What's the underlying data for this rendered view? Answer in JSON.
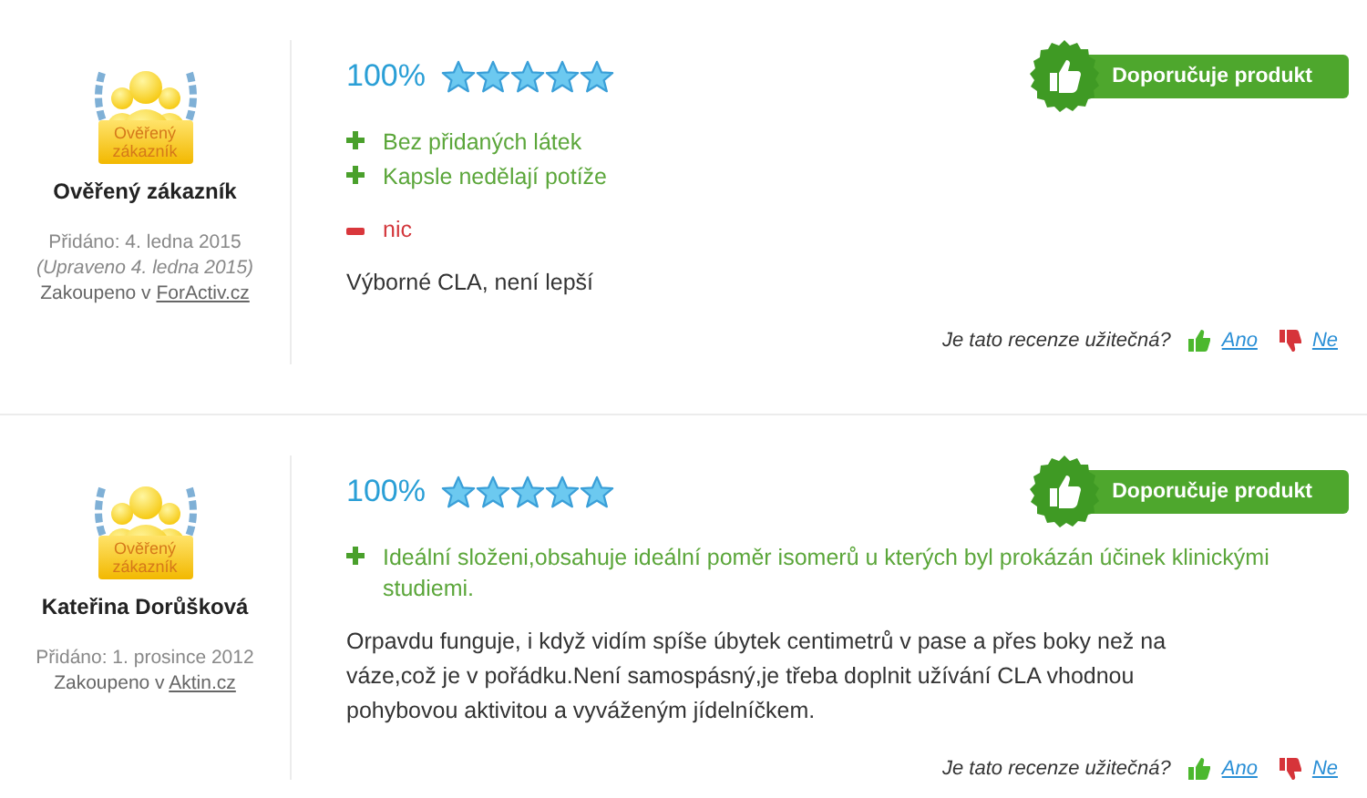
{
  "reviews": [
    {
      "author": {
        "badge_label": "Ověřený zákazník",
        "name": "Ověřený zákazník"
      },
      "added": "Přidáno: 4. ledna 2015",
      "edited": "(Upraveno 4. ledna 2015)",
      "purchased": "Zakoupeno v",
      "shop": "ForActiv.cz",
      "rating": "100%",
      "stars": 5,
      "recommend": "Doporučuje produkt",
      "pros": [
        "Bez přidaných látek",
        "Kapsle nedělají potíže"
      ],
      "cons": [
        "nic"
      ],
      "text": "Výborné CLA, není lepší",
      "helpful": {
        "question": "Je tato recenze užitečná?",
        "yes": "Ano",
        "no": "Ne"
      }
    },
    {
      "author": {
        "badge_label": "Ověřený zákazník",
        "name": "Kateřina Dorůšková"
      },
      "added": "Přidáno: 1. prosince 2012",
      "purchased": "Zakoupeno v",
      "shop": "Aktin.cz",
      "rating": "100%",
      "stars": 5,
      "recommend": "Doporučuje produkt",
      "pros": [
        "Ideální složeni,obsahuje ideální poměr isomerů u kterých byl prokázán účinek klinickými studiemi."
      ],
      "text": "Orpavdu funguje, i když vidím spíše úbytek centimetrů v pase a přes boky než na váze,což je v pořádku.Není samospásný,je třeba doplnit užívání CLA vhodnou pohybovou aktivitou a vyváženým jídelníčkem.",
      "helpful": {
        "question": "Je tato recenze užitečná?",
        "yes": "Ano",
        "no": "Ne"
      }
    }
  ]
}
